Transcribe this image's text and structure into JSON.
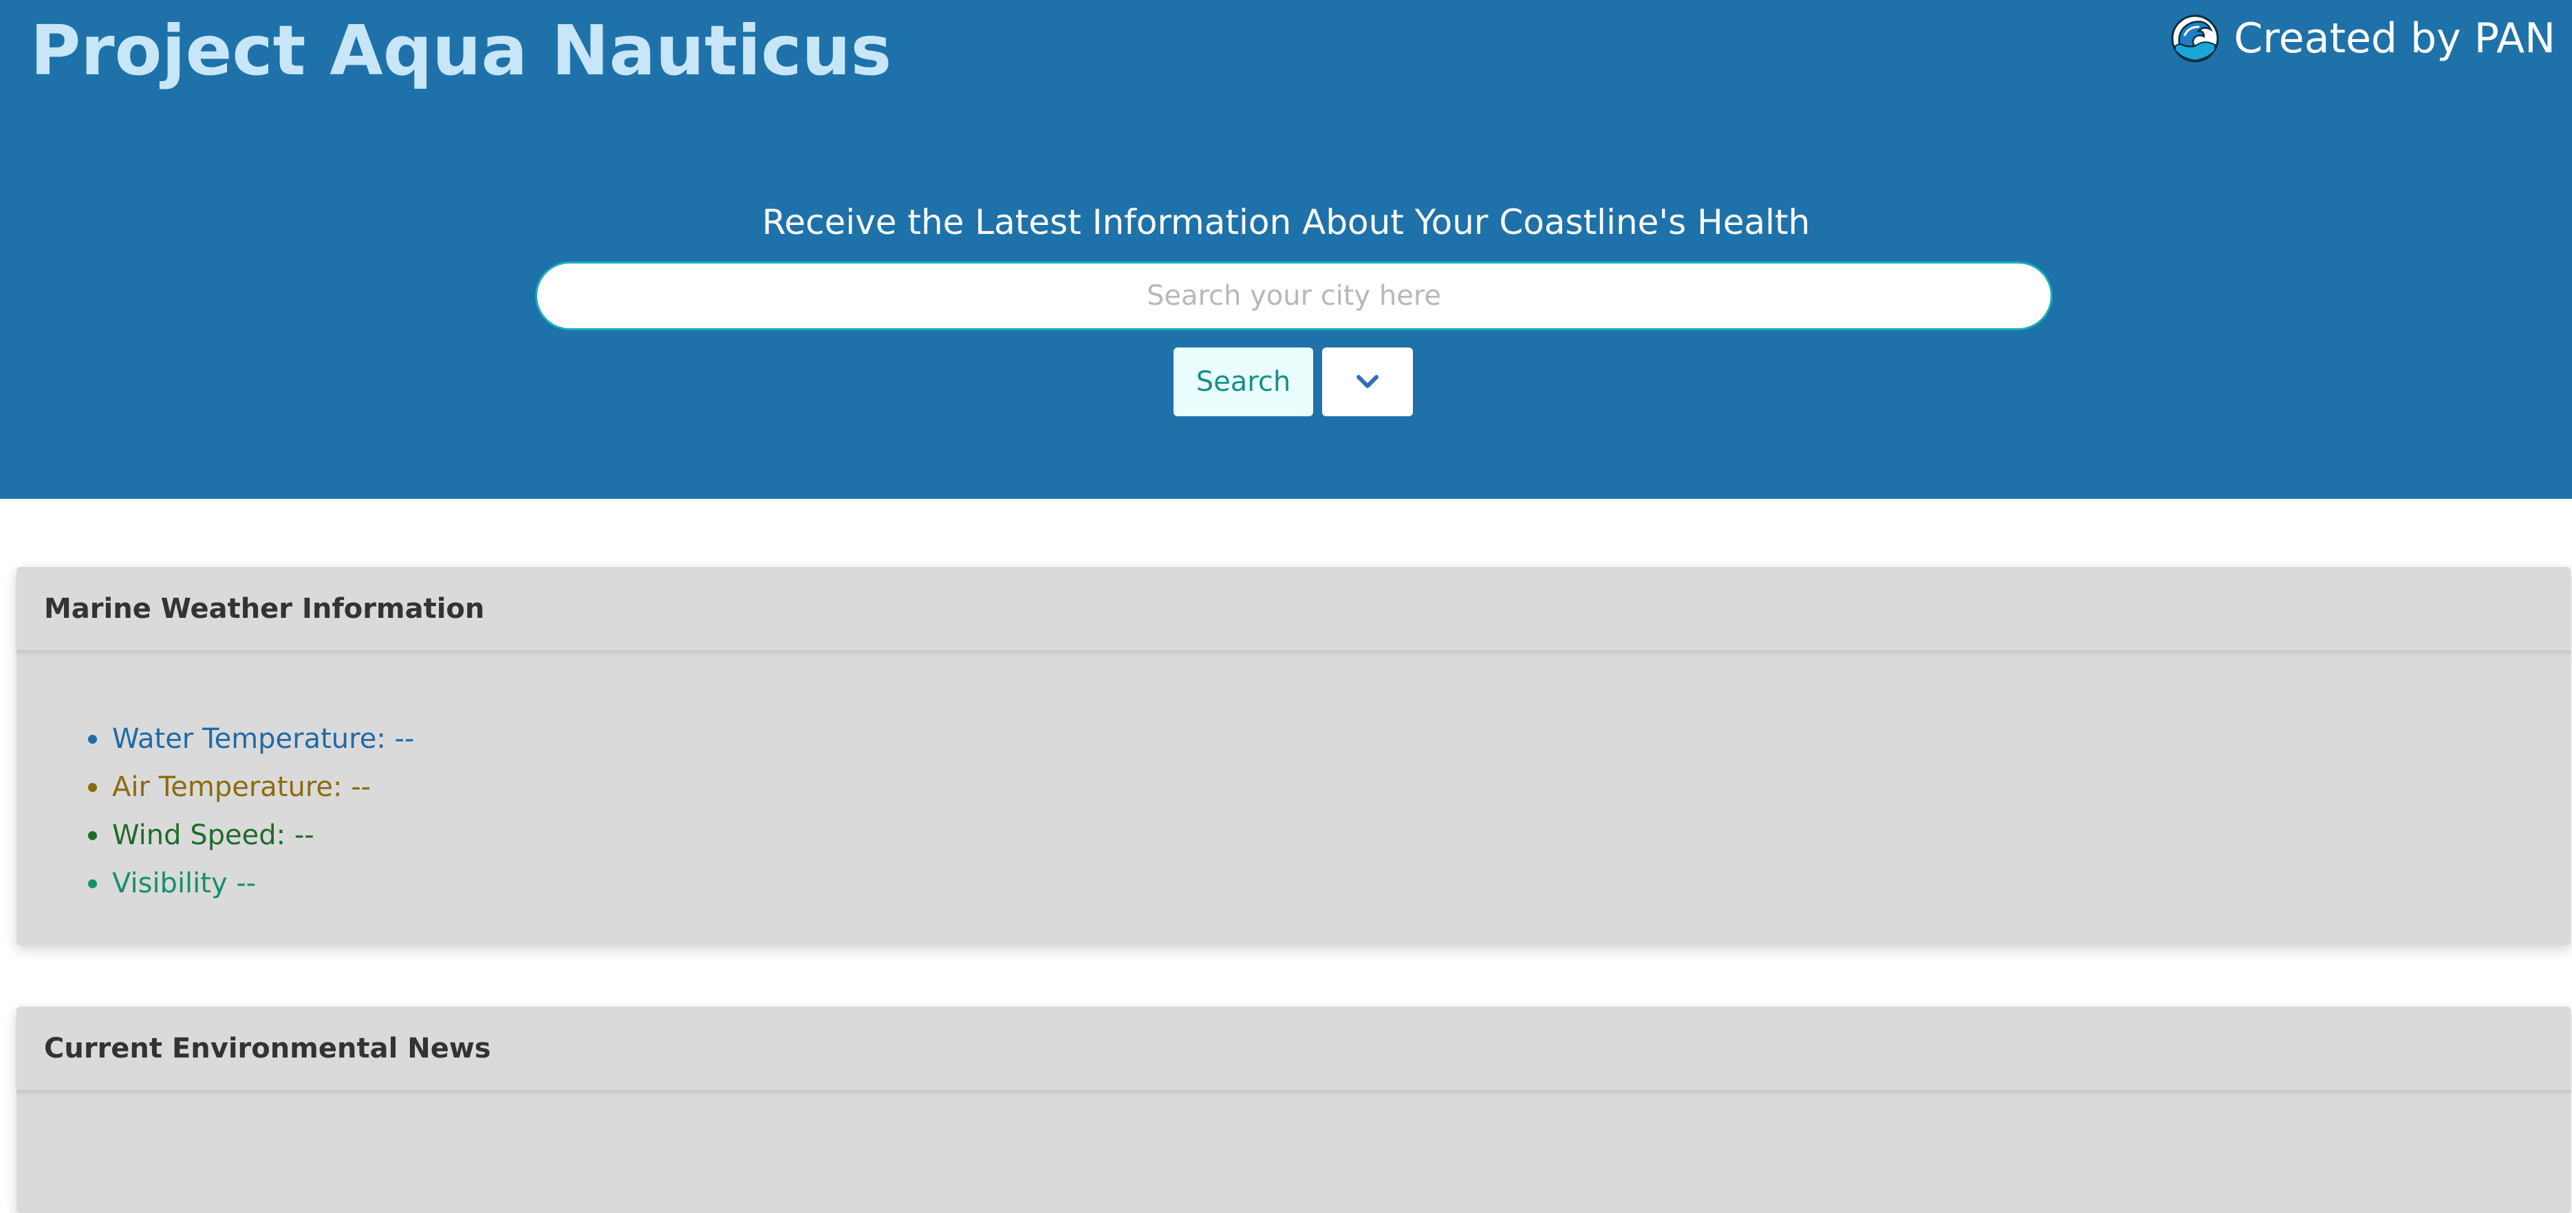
{
  "header": {
    "title": "Project Aqua Nauticus",
    "credit": "Created by PAN",
    "logo_icon": "wave-icon",
    "background_color": "#1f72a9"
  },
  "search": {
    "tagline": "Receive the Latest Information About Your Coastline's Health",
    "placeholder": "Search your city here",
    "value": "",
    "button_label": "Search",
    "dropdown_icon": "chevron-down-icon"
  },
  "weather_card": {
    "title": "Marine Weather Information",
    "items": [
      {
        "label": "Water Temperature: --",
        "color": "#1f6aa6"
      },
      {
        "label": "Air Temperature: --",
        "color": "#8c6a0c"
      },
      {
        "label": "Wind Speed: --",
        "color": "#1f6b2a"
      },
      {
        "label": "Visibility --",
        "color": "#168f6f"
      }
    ]
  },
  "news_card": {
    "title": "Current Environmental News"
  }
}
